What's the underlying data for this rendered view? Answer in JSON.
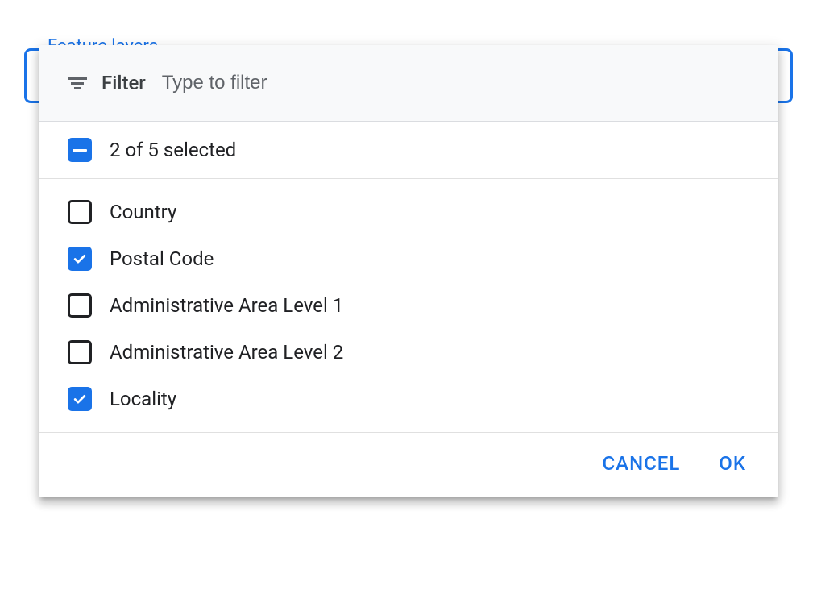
{
  "colors": {
    "accent": "#1a73e8"
  },
  "field": {
    "legend": "Feature layers"
  },
  "filter": {
    "label": "Filter",
    "placeholder": "Type to filter",
    "value": ""
  },
  "summary": {
    "state": "indeterminate",
    "text": "2 of 5 selected",
    "selected_count": 2,
    "total_count": 5
  },
  "options": [
    {
      "id": "country",
      "label": "Country",
      "checked": false
    },
    {
      "id": "postal",
      "label": "Postal Code",
      "checked": true
    },
    {
      "id": "admin1",
      "label": "Administrative Area Level 1",
      "checked": false
    },
    {
      "id": "admin2",
      "label": "Administrative Area Level 2",
      "checked": false
    },
    {
      "id": "locality",
      "label": "Locality",
      "checked": true
    }
  ],
  "buttons": {
    "cancel": "CANCEL",
    "ok": "OK"
  }
}
